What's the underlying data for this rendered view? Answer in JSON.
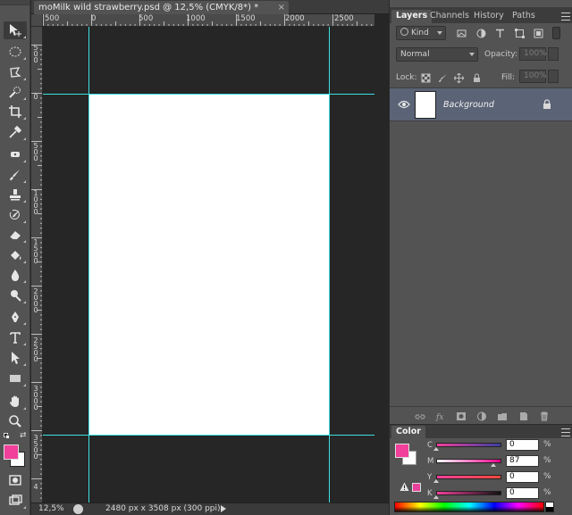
{
  "document": {
    "tab_title": "moMilk wild strawberry.psd @ 12,5% (CMYK/8*) *",
    "close_glyph": "×",
    "zoom": "12,5%",
    "info": "2480 px x 3508 px (300 ppi)"
  },
  "ruler_h": {
    "labels": [
      "500",
      "0",
      "500",
      "1000",
      "1500",
      "2000",
      "2500"
    ]
  },
  "ruler_v": {
    "labels": [
      "500",
      "0",
      "500",
      "1000",
      "1500",
      "2000",
      "2500",
      "3000",
      "3500",
      "4"
    ]
  },
  "layers_panel": {
    "tabs": [
      "Layers",
      "Channels",
      "History",
      "Paths"
    ],
    "active_tab": "Layers",
    "filter_kind": "Kind",
    "blend_mode": "Normal",
    "opacity_label": "Opacity:",
    "opacity_value": "100%",
    "lock_label": "Lock:",
    "fill_label": "Fill:",
    "fill_value": "100%",
    "layers": [
      {
        "name": "Background",
        "visible": true,
        "locked": true
      }
    ]
  },
  "color_panel": {
    "title": "Color",
    "foreground": "#f13f9b",
    "background": "#ffffff",
    "channels": [
      {
        "label": "C",
        "value": "0",
        "unit": "%",
        "fraction": 0.0
      },
      {
        "label": "M",
        "value": "87",
        "unit": "%",
        "fraction": 0.87
      },
      {
        "label": "Y",
        "value": "0",
        "unit": "%",
        "fraction": 0.0
      },
      {
        "label": "K",
        "value": "0",
        "unit": "%",
        "fraction": 0.0
      }
    ]
  },
  "colors": {
    "guide": "#3ee0e0",
    "accent_magenta": "#f13f9b",
    "selected_layer": "#5b6476"
  }
}
